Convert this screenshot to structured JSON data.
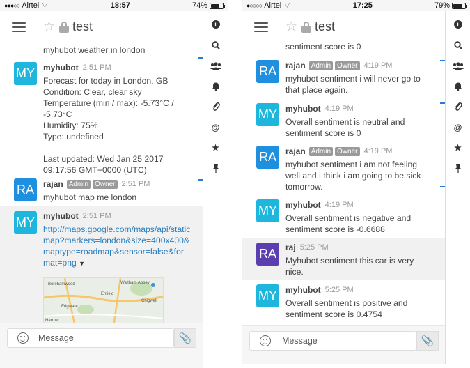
{
  "left": {
    "status": {
      "carrier": "Airtel",
      "time": "18:57",
      "battery_text": "74%",
      "battery_level": 0.74
    },
    "header": {
      "room": "test"
    },
    "messages": [
      {
        "type": "cont",
        "text": "myhubot weather in london"
      },
      {
        "type": "msg",
        "avatar": "MY",
        "user": "myhubot",
        "time": "2:51 PM",
        "text": "Forecast for today in London, GB\nCondition: Clear, clear sky\nTemperature (min / max): -5.73°C / -5.73°C\nHumidity: 75%\nType: undefined\n\nLast updated: Wed Jan 25 2017 09:17:56 GMT+0000 (UTC)"
      },
      {
        "type": "msg",
        "avatar": "RA",
        "user": "rajan",
        "badges": [
          "Admin",
          "Owner"
        ],
        "time": "2:51 PM",
        "text": "myhubot map me london"
      },
      {
        "type": "msg",
        "avatar": "MY",
        "user": "myhubot",
        "time": "2:51 PM",
        "link": "http://maps.google.com/maps/api/staticmap?markers=london&size=400x400&maptype=roadmap&sensor=false&format=png",
        "caret": "▼"
      }
    ],
    "map_labels": [
      "Borehamwood",
      "Enfield",
      "Waltham Abbey",
      "Chigwell",
      "Edgware",
      "Harrow"
    ],
    "composer": {
      "placeholder": "Message"
    }
  },
  "right": {
    "status": {
      "carrier": "Airtel",
      "time": "17:25",
      "battery_text": "79%",
      "battery_level": 0.79
    },
    "header": {
      "room": "test"
    },
    "messages": [
      {
        "type": "cont",
        "text": "sentiment score is 0"
      },
      {
        "type": "msg",
        "avatar": "RA",
        "user": "rajan",
        "badges": [
          "Admin",
          "Owner"
        ],
        "time": "4:19 PM",
        "text": "myhubot sentiment i will never go to that place again."
      },
      {
        "type": "msg",
        "avatar": "MY",
        "user": "myhubot",
        "time": "4:19 PM",
        "text": "Overall sentiment is neutral and sentiment score is 0"
      },
      {
        "type": "msg",
        "avatar": "RA",
        "user": "rajan",
        "badges": [
          "Admin",
          "Owner"
        ],
        "time": "4:19 PM",
        "text": "myhubot sentiment i am not feeling well and i think i am going to be sick tomorrow."
      },
      {
        "type": "msg",
        "avatar": "MY",
        "user": "myhubot",
        "time": "4:19 PM",
        "text": "Overall sentiment is negative and sentiment score is -0.6688"
      },
      {
        "type": "msg",
        "avatar": "RA",
        "user": "raj",
        "time": "5:25 PM",
        "text": "Myhubot sentiment this car is very nice."
      },
      {
        "type": "msg",
        "avatar": "MY",
        "user": "myhubot",
        "time": "5:25 PM",
        "text": "Overall sentiment is positive and sentiment score is 0.4754"
      }
    ],
    "composer": {
      "placeholder": "Message"
    }
  },
  "rail_icons": [
    "info-icon",
    "search-icon",
    "members-icon",
    "bell-icon",
    "paperclip-icon",
    "mention-icon",
    "star-icon",
    "pin-icon"
  ],
  "colors": {
    "myhubot_avatar": "#1eb6dd",
    "rajan_avatar": "#1f8fe0",
    "raj_avatar": "#5b3fb0",
    "link": "#2a7fc0",
    "tick": "#2b7bd1"
  }
}
